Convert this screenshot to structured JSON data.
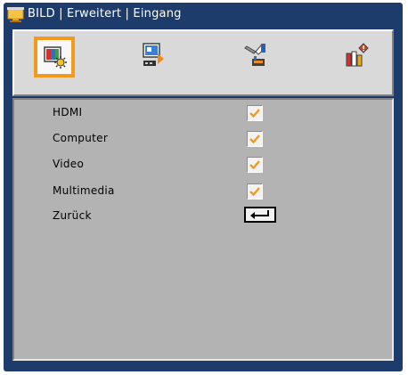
{
  "window": {
    "title": "BILD | Erweitert | Eingang",
    "title_icon": "projector-screen-icon"
  },
  "tabs": [
    {
      "icon": "picture-settings-icon",
      "active": true
    },
    {
      "icon": "display-settings-icon",
      "active": false
    },
    {
      "icon": "setup-tools-icon",
      "active": false
    },
    {
      "icon": "info-options-icon",
      "active": false
    }
  ],
  "menu": {
    "items": [
      {
        "label": "HDMI",
        "checked": true
      },
      {
        "label": "Computer",
        "checked": true
      },
      {
        "label": "Video",
        "checked": true
      },
      {
        "label": "Multimedia",
        "checked": true
      }
    ],
    "back": {
      "label": "Zurück",
      "icon": "enter-return-icon"
    }
  },
  "colors": {
    "frame": "#1d3c6b",
    "active_tab_border": "#f39a1e",
    "panel": "#b3b3b3",
    "check": "#f39a1e"
  }
}
